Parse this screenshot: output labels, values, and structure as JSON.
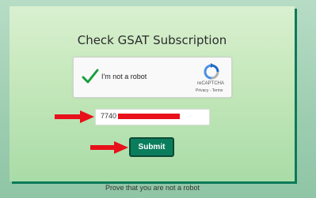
{
  "page": {
    "title": "Check GSAT Subscription",
    "footer": "Prove that you are not a robot"
  },
  "captcha": {
    "label": "I'm not a robot",
    "brand": "reCAPTCHA",
    "links": "Privacy - Terms",
    "checked": true
  },
  "form": {
    "field_value": "7740"
  },
  "submit": {
    "label": "Submit"
  },
  "colors": {
    "accent": "#0a7d5c",
    "annotation": "#e8101a"
  },
  "icons": {
    "check": "check-icon",
    "recaptcha": "recaptcha-logo-icon",
    "arrow": "right-arrow-icon"
  }
}
